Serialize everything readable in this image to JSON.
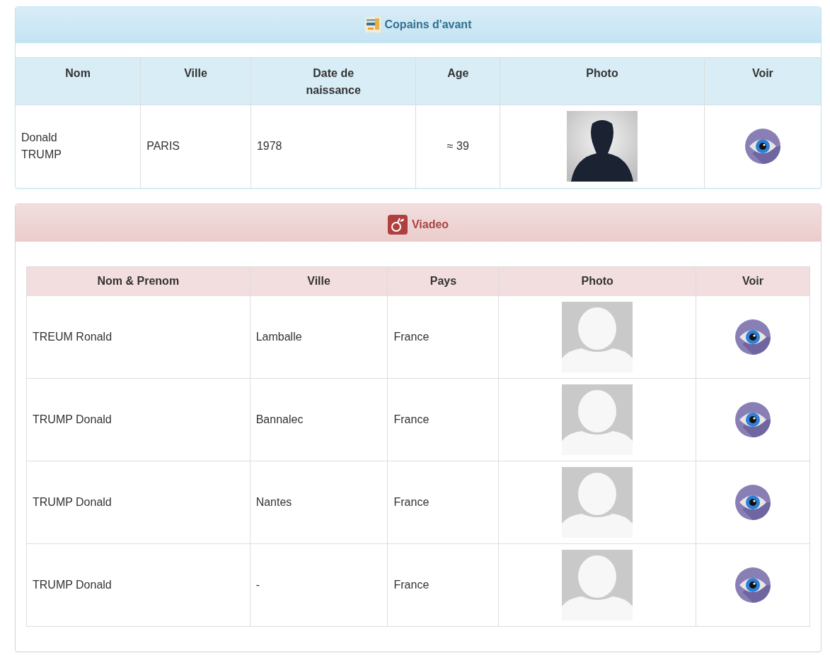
{
  "panels": [
    {
      "title": "Copains d'avant",
      "kind": "copains",
      "columns": [
        {
          "label": "Nom",
          "kind": "text"
        },
        {
          "label": "Ville",
          "kind": "text"
        },
        {
          "label": "Date de\nnaissance",
          "kind": "text"
        },
        {
          "label": "Age",
          "kind": "number"
        },
        {
          "label": "Photo",
          "kind": "photo"
        },
        {
          "label": "Voir",
          "kind": "action"
        }
      ],
      "rows": [
        {
          "cells": [
            "Donald\nTRUMP",
            "PARIS",
            "1978",
            "≈ 39"
          ],
          "kind": "silhouette"
        }
      ]
    },
    {
      "title": "Viadeo",
      "kind": "viadeo",
      "columns": [
        {
          "label": "Nom & Prenom",
          "kind": "text"
        },
        {
          "label": "Ville",
          "kind": "text"
        },
        {
          "label": "Pays",
          "kind": "text"
        },
        {
          "label": "Photo",
          "kind": "photo"
        },
        {
          "label": "Voir",
          "kind": "action"
        }
      ],
      "rows": [
        {
          "cells": [
            "TREUM Ronald",
            "Lamballe",
            "France"
          ],
          "kind": "placeholder"
        },
        {
          "cells": [
            "TRUMP Donald",
            "Bannalec",
            "France"
          ],
          "kind": "placeholder"
        },
        {
          "cells": [
            "TRUMP Donald",
            "Nantes",
            "France"
          ],
          "kind": "placeholder"
        },
        {
          "cells": [
            "TRUMP Donald",
            "-",
            "France"
          ],
          "kind": "placeholder"
        }
      ]
    }
  ]
}
